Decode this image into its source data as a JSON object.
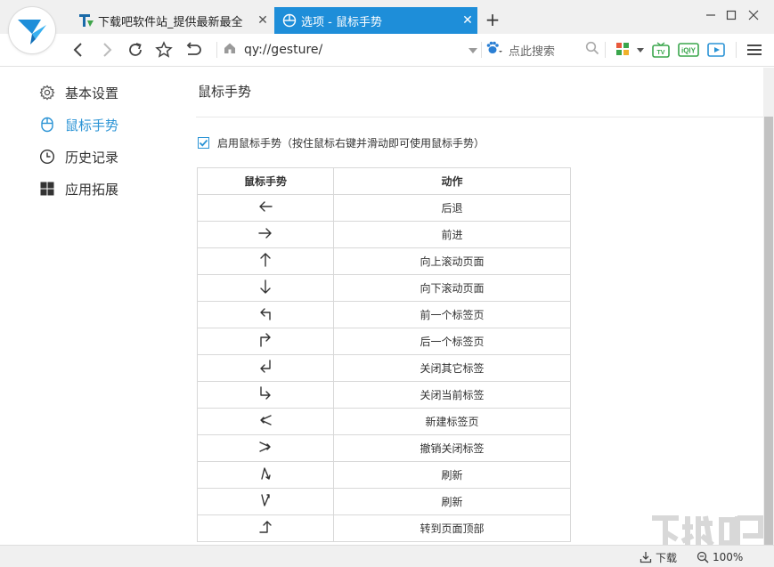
{
  "tabs": [
    {
      "title": "下载吧软件站_提供最新最全"
    },
    {
      "title": "选项 - 鼠标手势"
    }
  ],
  "toolbar": {
    "address": "qy://gesture/",
    "search_placeholder": "点此搜索"
  },
  "sidebar": {
    "items": [
      {
        "label": "基本设置"
      },
      {
        "label": "鼠标手势"
      },
      {
        "label": "历史记录"
      },
      {
        "label": "应用拓展"
      }
    ]
  },
  "content": {
    "title": "鼠标手势",
    "enable_label": "启用鼠标手势（按住鼠标右键并滑动即可使用鼠标手势）",
    "enable_checked": true,
    "table_headers": [
      "鼠标手势",
      "动作"
    ],
    "rows": [
      {
        "gesture": "left-arrow-icon",
        "action": "后退"
      },
      {
        "gesture": "right-arrow-icon",
        "action": "前进"
      },
      {
        "gesture": "up-arrow-icon",
        "action": "向上滚动页面"
      },
      {
        "gesture": "down-arrow-icon",
        "action": "向下滚动页面"
      },
      {
        "gesture": "up-left-arrow-icon",
        "action": "前一个标签页"
      },
      {
        "gesture": "up-right-arrow-icon",
        "action": "后一个标签页"
      },
      {
        "gesture": "down-left-arrow-icon",
        "action": "关闭其它标签"
      },
      {
        "gesture": "down-right-arrow-icon",
        "action": "关闭当前标签"
      },
      {
        "gesture": "left-zigzag-icon",
        "action": "新建标签页"
      },
      {
        "gesture": "right-zigzag-icon",
        "action": "撤销关闭标签"
      },
      {
        "gesture": "up-zigzag-icon",
        "action": "刷新"
      },
      {
        "gesture": "down-zigzag-icon",
        "action": "刷新"
      },
      {
        "gesture": "right-up-arrow-icon",
        "action": "转到页面顶部"
      }
    ]
  },
  "statusbar": {
    "download_label": "下载",
    "zoom": "100%"
  },
  "colors": {
    "accent": "#1e8ed9",
    "active_link": "#2a93d5"
  }
}
